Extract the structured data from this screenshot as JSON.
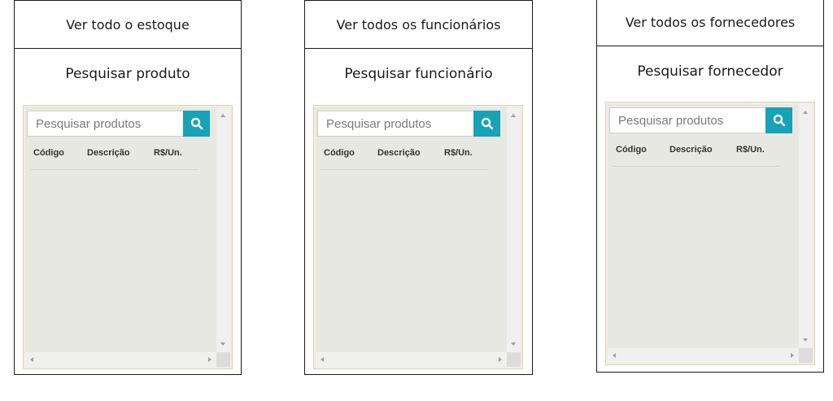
{
  "cards": [
    {
      "header": "Ver todo o estoque",
      "subtitle": "Pesquisar produto",
      "search": {
        "placeholder": "Pesquisar produtos"
      },
      "columns": [
        "Código",
        "Descrição",
        "R$/Un."
      ]
    },
    {
      "header": "Ver todos os funcionários",
      "subtitle": "Pesquisar funcionário",
      "search": {
        "placeholder": "Pesquisar produtos"
      },
      "columns": [
        "Código",
        "Descrição",
        "R$/Un."
      ]
    },
    {
      "header": "Ver todos os fornecedores",
      "subtitle": "Pesquisar fornecedor",
      "search": {
        "placeholder": "Pesquisar produtos"
      },
      "columns": [
        "Código",
        "Descrição",
        "R$/Un."
      ]
    }
  ],
  "icons": {
    "search_button": "search-icon",
    "scroll_up": "arrow-up-icon",
    "scroll_down": "arrow-down-icon",
    "scroll_left": "arrow-left-icon",
    "scroll_right": "arrow-right-icon"
  },
  "colors": {
    "search_button": "#17a2b8",
    "panel_background": "#e8e8e2",
    "panel_border": "#f3eedb",
    "card_border": "#1a1a1a"
  }
}
